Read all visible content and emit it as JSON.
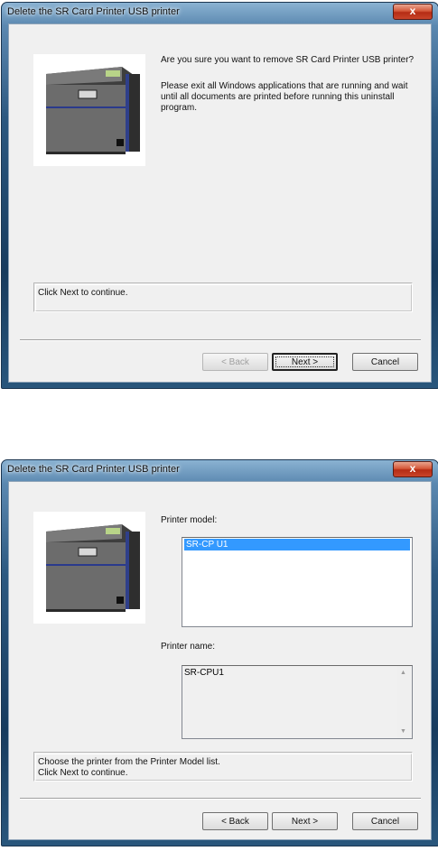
{
  "dialog1": {
    "title": "Delete the SR Card Printer  USB printer",
    "close_label": "x",
    "message1": "Are you sure you want to remove SR Card Printer  USB printer?",
    "message2": "Please exit all Windows applications that are running and wait until all documents are printed before running this uninstall program.",
    "status": "Click Next to continue.",
    "buttons": {
      "back": "< Back",
      "next": "Next >",
      "cancel": "Cancel"
    }
  },
  "dialog2": {
    "title": "Delete the SR Card Printer  USB printer",
    "close_label": "x",
    "model_label": "Printer model:",
    "model_items": [
      "SR-CP U1"
    ],
    "name_label": "Printer name:",
    "name_value": "SR-CPU1",
    "status_line1": "Choose the printer from the Printer Model list.",
    "status_line2": "Click Next to continue.",
    "buttons": {
      "back": "< Back",
      "next": "Next >",
      "cancel": "Cancel"
    }
  },
  "colors": {
    "selection": "#3399ff",
    "close_button": "#c9442a",
    "frame": "#173b5e"
  },
  "icons": [
    "close-icon",
    "card-printer-image",
    "scroll-up-icon",
    "scroll-down-icon"
  ]
}
